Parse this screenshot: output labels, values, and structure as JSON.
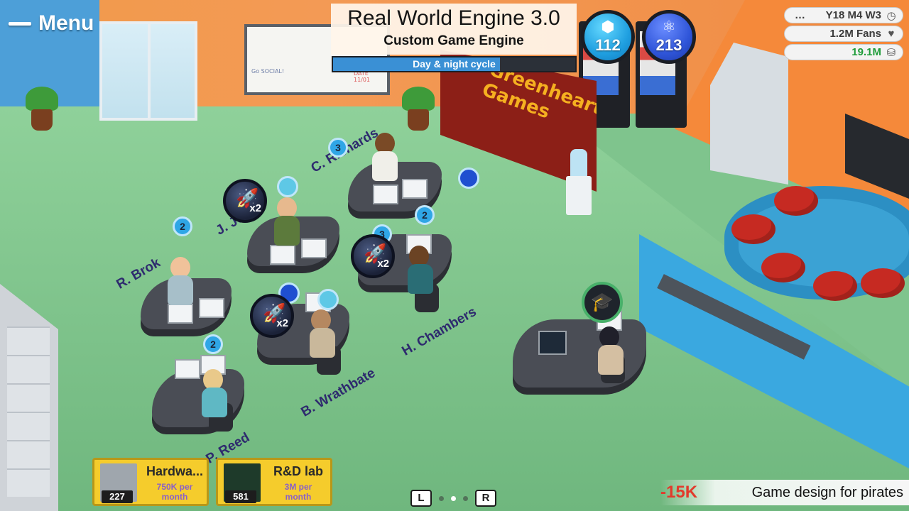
{
  "hud": {
    "menu_label": "Menu",
    "project": {
      "title": "Real World Engine 3.0",
      "subtitle": "Custom Game Engine",
      "progress_label": "Day & night cycle",
      "progress_fraction": 0.69
    },
    "points": {
      "design": "112",
      "tech": "213"
    },
    "stats": {
      "date": "Y18 M4 W3",
      "fans": "1.2M Fans",
      "cash": "19.1M"
    },
    "bottom_cards": [
      {
        "title": "Hardwa...",
        "cost_line1": "750K per",
        "cost_line2": "month",
        "count": "227"
      },
      {
        "title": "R&D lab",
        "cost_line1": "3M per",
        "cost_line2": "month",
        "count": "581"
      }
    ],
    "pager": {
      "left_key": "L",
      "right_key": "R",
      "active_page": 2,
      "page_count": 3
    },
    "status_bar": {
      "change": "-15K",
      "topic": "Game design for pirates"
    }
  },
  "scene": {
    "company_logo_line1": "Greenheart",
    "company_logo_line2": "Games",
    "whiteboard_notes": [
      "Go SOCIAL!",
      "RELEASE DATE 11/01"
    ],
    "workers": [
      {
        "name": "C. Richards",
        "research_points": "3"
      },
      {
        "name": "J. Jo",
        "boost": "x2"
      },
      {
        "name": "R. Brok",
        "research_points": "2"
      },
      {
        "name": "H. Chambers",
        "research_points": "3",
        "boost": "x2",
        "second_points": "2"
      },
      {
        "name": "B. Wrathbate",
        "boost": "x2"
      },
      {
        "name": "P. Reed",
        "research_points": "2"
      }
    ]
  },
  "colors": {
    "design_orb": "#1f9fe0",
    "tech_orb": "#2f55d9",
    "cash_green": "#1e9c3a",
    "loss_red": "#e23a2c",
    "card_yellow": "#f5cc2c",
    "name_purple": "#2e2a6e"
  },
  "icons": {
    "menu": "hamburger-icon",
    "design": "cube-icon",
    "tech": "atom-icon",
    "date": "clock-icon",
    "fans": "heart-icon",
    "cash": "coins-icon",
    "boost": "rocket-icon",
    "training": "graduation-cap-icon"
  }
}
